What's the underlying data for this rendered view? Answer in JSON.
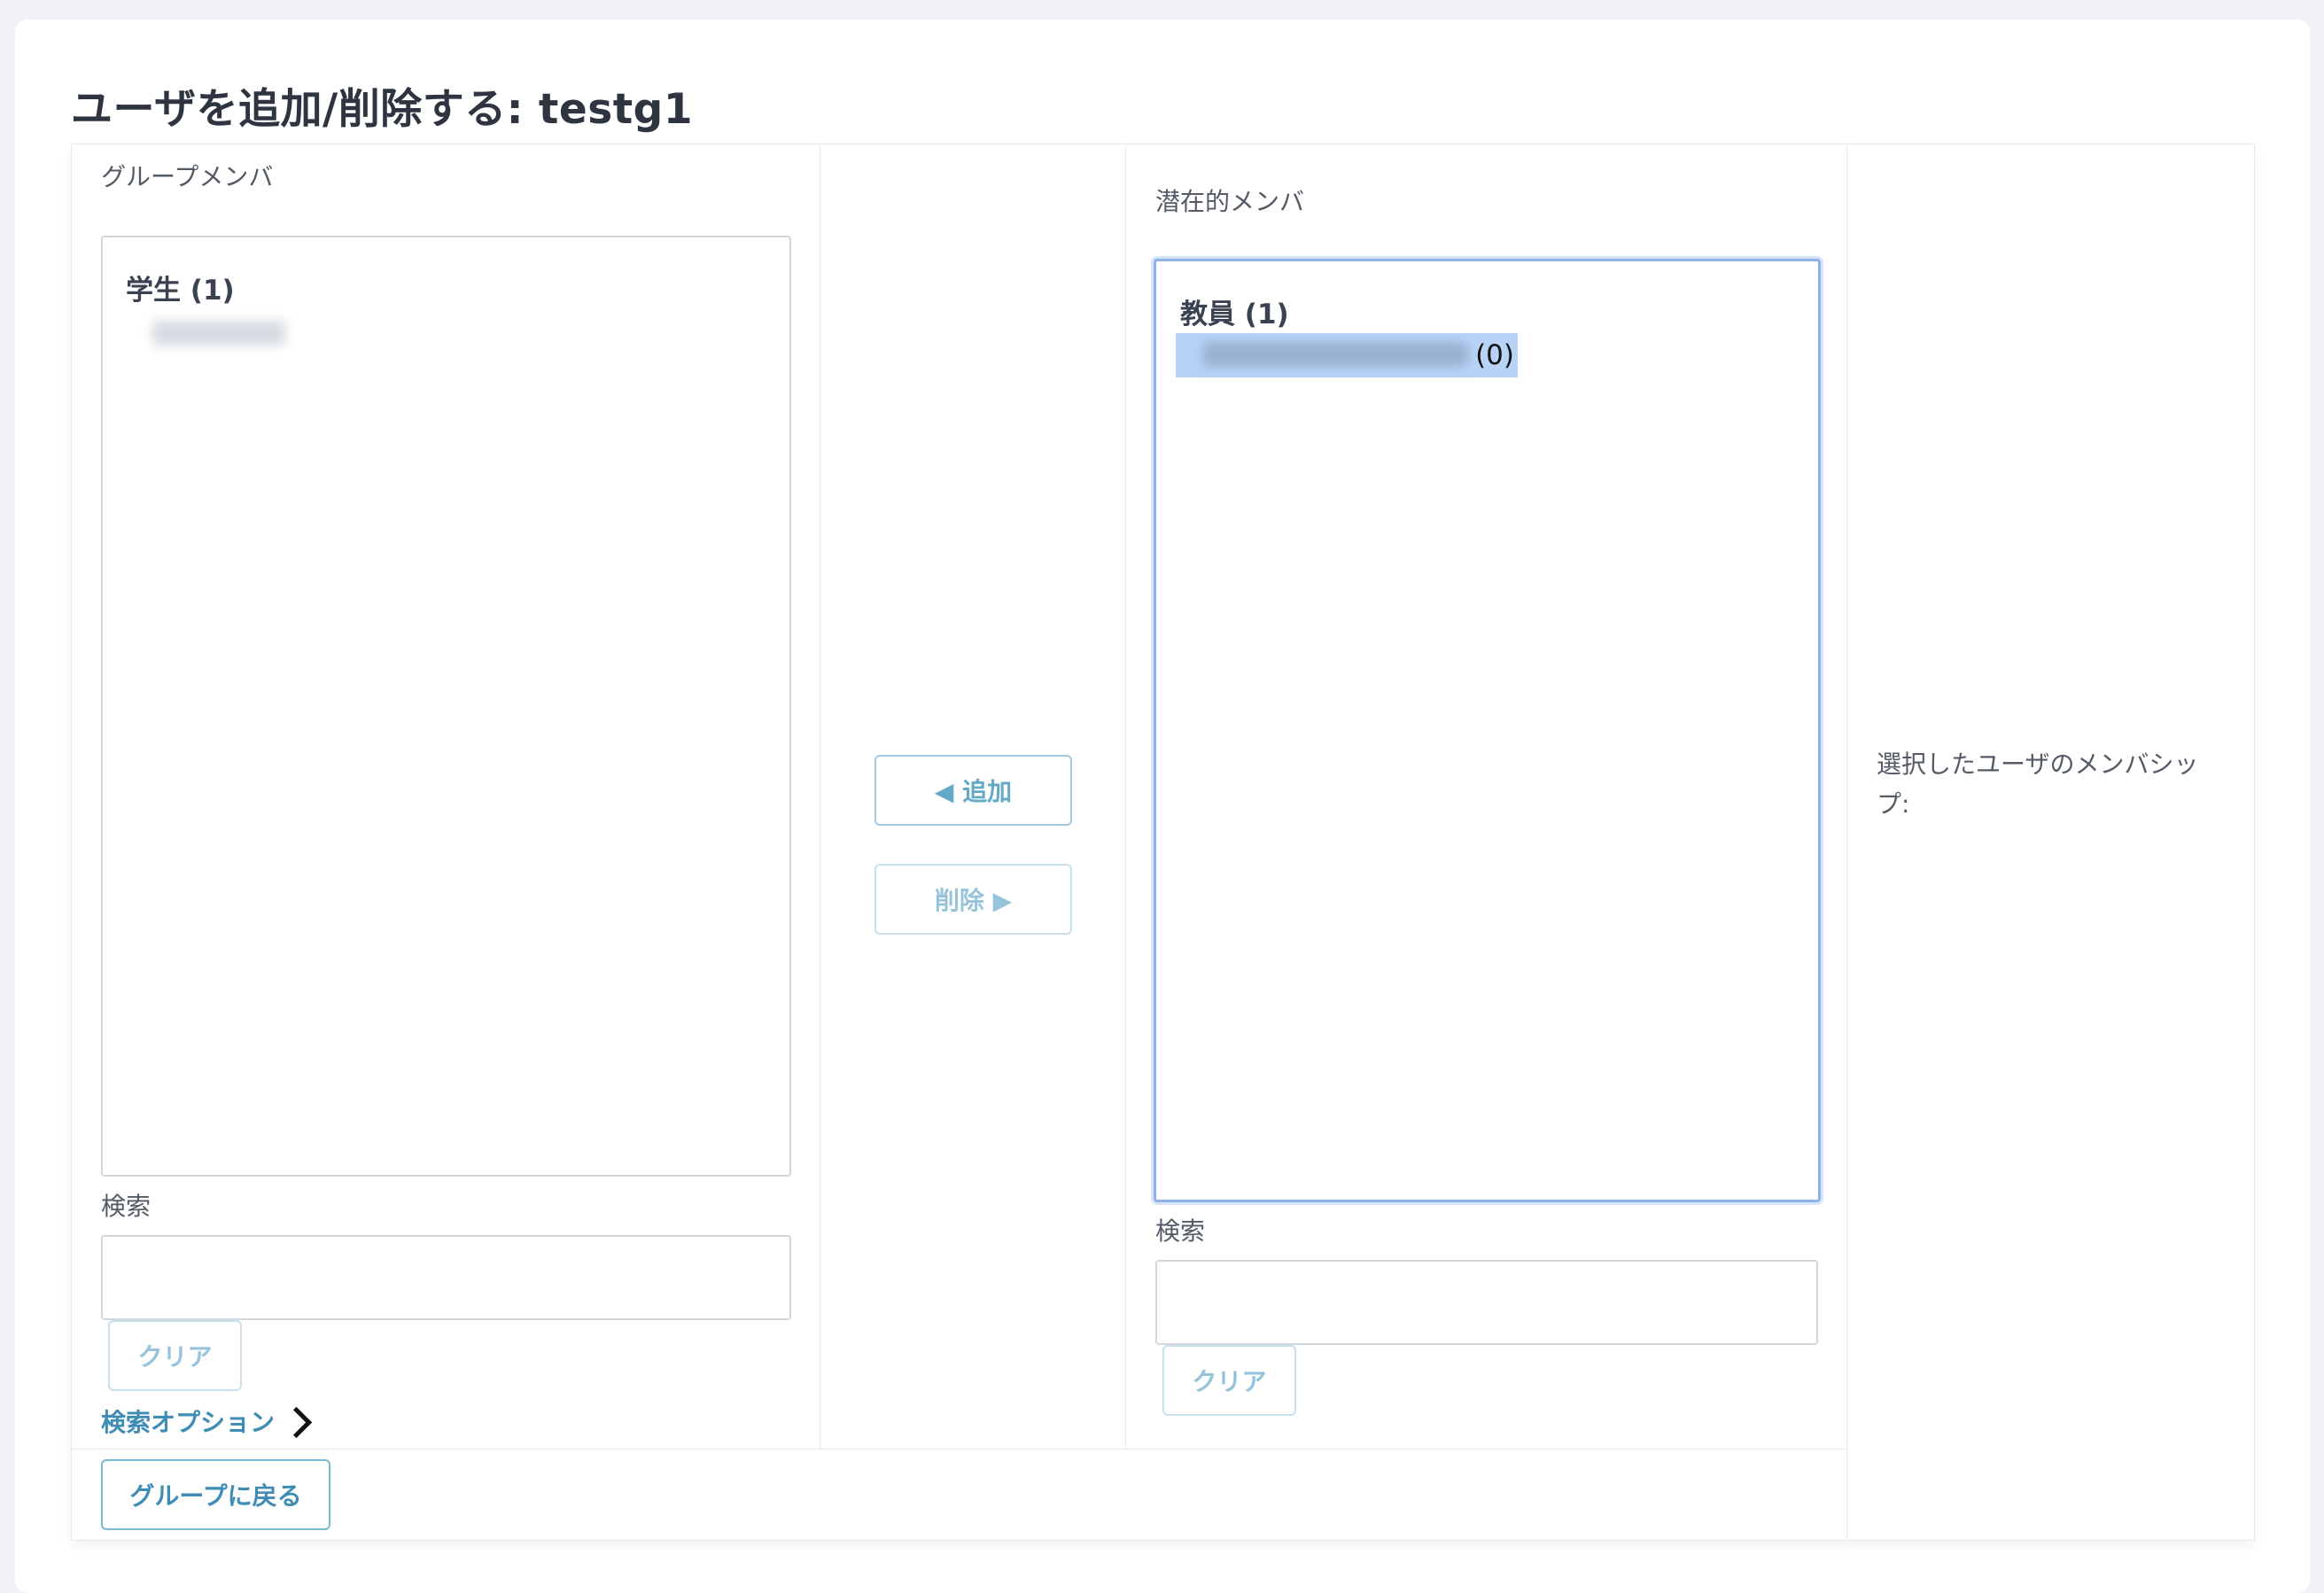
{
  "page": {
    "title": "ユーザを追加/削除する: testg1"
  },
  "left": {
    "heading": "グループメンバ",
    "group": "学生 (1)",
    "search_label": "検索",
    "search_value": "",
    "clear_label": "クリア",
    "search_options_label": "検索オプション"
  },
  "actions": {
    "add_label": "◀ 追加",
    "remove_label": "削除 ▶"
  },
  "right": {
    "heading": "潜在的メンバ",
    "group": "教員 (1)",
    "selected_count": "(0)",
    "search_label": "検索",
    "search_value": "",
    "clear_label": "クリア"
  },
  "info": {
    "membership_label": "選択したユーザのメンバシップ:"
  },
  "footer": {
    "back_label": "グループに戻る"
  }
}
